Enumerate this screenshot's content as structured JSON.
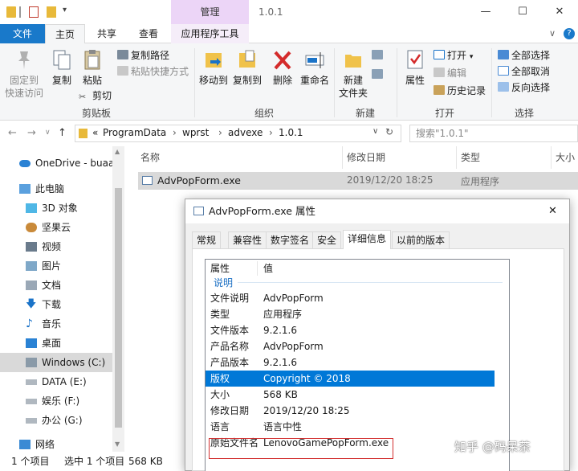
{
  "window": {
    "title": "1.0.1",
    "context_tab": "管理",
    "controls": {
      "minimize": "—",
      "maximize": "☐",
      "close": "✕"
    }
  },
  "ribbon_tabs": {
    "file": "文件",
    "home": "主页",
    "share": "共享",
    "view": "查看",
    "app_tools": "应用程序工具",
    "collapse": "∨",
    "help": "?"
  },
  "ribbon": {
    "clipboard": {
      "label": "剪贴板",
      "pin_line1": "固定到",
      "pin_line2": "快速访问",
      "copy": "复制",
      "paste": "粘贴",
      "copy_path": "复制路径",
      "paste_shortcut": "粘贴快捷方式",
      "cut": "剪切"
    },
    "organize": {
      "label": "组织",
      "move_to": "移动到",
      "copy_to": "复制到",
      "delete": "删除",
      "rename": "重命名"
    },
    "new": {
      "label": "新建",
      "new_folder_line1": "新建",
      "new_folder_line2": "文件夹"
    },
    "open": {
      "label": "打开",
      "properties": "属性",
      "open": "打开",
      "edit": "编辑",
      "history": "历史记录"
    },
    "select": {
      "label": "选择",
      "select_all": "全部选择",
      "select_none": "全部取消",
      "invert": "反向选择"
    }
  },
  "address": {
    "segments": [
      "«",
      "ProgramData",
      "›",
      "wprst",
      "›",
      "advexe",
      "›",
      "1.0.1"
    ],
    "search_placeholder": "搜索\"1.0.1\""
  },
  "nav": {
    "items": [
      {
        "label": "OneDrive - buaa"
      },
      {
        "label": "此电脑"
      },
      {
        "label": "3D 对象"
      },
      {
        "label": "坚果云"
      },
      {
        "label": "视频"
      },
      {
        "label": "图片"
      },
      {
        "label": "文档"
      },
      {
        "label": "下载"
      },
      {
        "label": "音乐"
      },
      {
        "label": "桌面"
      },
      {
        "label": "Windows (C:)"
      },
      {
        "label": "DATA (E:)"
      },
      {
        "label": "娱乐 (F:)"
      },
      {
        "label": "办公 (G:)"
      },
      {
        "label": "网络"
      }
    ]
  },
  "filelist": {
    "columns": [
      "名称",
      "修改日期",
      "类型",
      "大小"
    ],
    "rows": [
      {
        "name": "AdvPopForm.exe",
        "date": "2019/12/20 18:25",
        "type": "应用程序"
      }
    ]
  },
  "status": {
    "count": "1 个项目",
    "selected": "选中 1 个项目",
    "size": "568 KB"
  },
  "dialog": {
    "title": "AdvPopForm.exe 属性",
    "close": "✕",
    "tabs": [
      "常规",
      "兼容性",
      "数字签名",
      "安全",
      "详细信息",
      "以前的版本"
    ],
    "list_header": {
      "property": "属性",
      "value": "值"
    },
    "section": "说明",
    "rows": [
      {
        "k": "文件说明",
        "v": "AdvPopForm"
      },
      {
        "k": "类型",
        "v": "应用程序"
      },
      {
        "k": "文件版本",
        "v": "9.2.1.6"
      },
      {
        "k": "产品名称",
        "v": "AdvPopForm"
      },
      {
        "k": "产品版本",
        "v": "9.2.1.6"
      },
      {
        "k": "版权",
        "v": "Copyright ©  2018"
      },
      {
        "k": "大小",
        "v": "568 KB"
      },
      {
        "k": "修改日期",
        "v": "2019/12/20 18:25"
      },
      {
        "k": "语言",
        "v": "语言中性"
      },
      {
        "k": "原始文件名",
        "v": "LenovoGamePopForm.exe"
      }
    ]
  },
  "watermark": "知乎 @码呆茶"
}
